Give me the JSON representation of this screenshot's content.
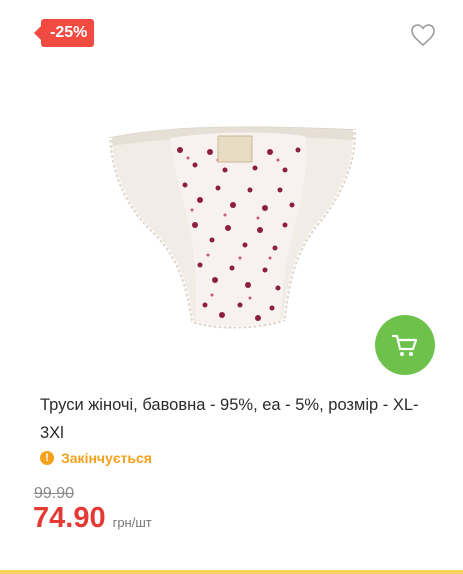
{
  "badge": {
    "discount": "-25%"
  },
  "product": {
    "title": "Труси жіночі, бавовна - 95%, еа - 5%, розмір - XL-3Xl",
    "stock_status": "Закінчується",
    "old_price": "99.90",
    "price": "74.90",
    "unit": "грн/шт"
  },
  "icons": {
    "favorite": "heart-outline-icon",
    "cart": "cart-icon",
    "stock": "warning-icon"
  },
  "colors": {
    "badge": "#f04a41",
    "cart_button": "#6ec24c",
    "warning": "#f4a21b",
    "price": "#e53935",
    "bottom_accent": "#f5d55b"
  }
}
